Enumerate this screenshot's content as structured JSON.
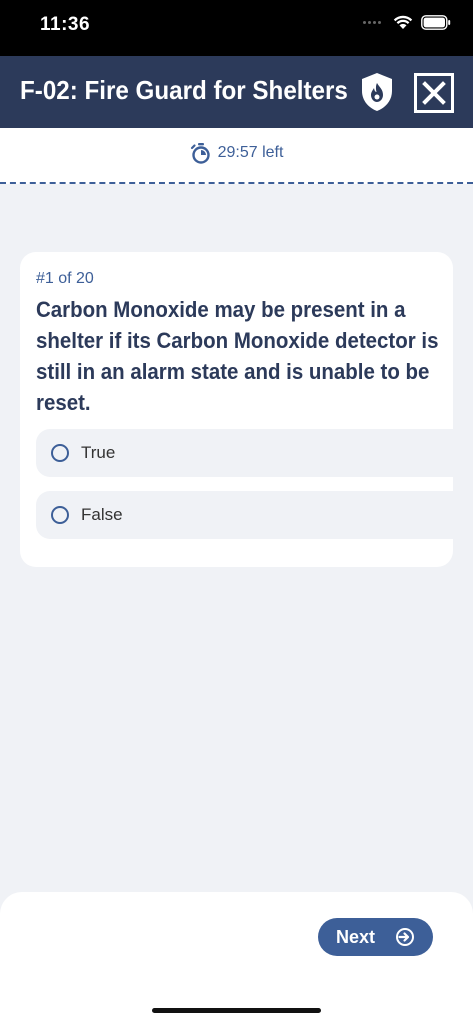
{
  "status_bar": {
    "time": "11:36"
  },
  "header": {
    "title": "F-02: Fire Guard for Shelters"
  },
  "timer": {
    "text": "29:57 left"
  },
  "question": {
    "number": "#1 of 20",
    "text": "Carbon Monoxide may be present in a shelter if its Carbon Monoxide detector is still in an alarm state and is unable to be reset.",
    "options": [
      {
        "label": "True"
      },
      {
        "label": "False"
      }
    ]
  },
  "footer": {
    "next_label": "Next"
  },
  "colors": {
    "header_bg": "#2c3a5a",
    "accent": "#3d5f98",
    "page_bg": "#f0f2f6"
  }
}
